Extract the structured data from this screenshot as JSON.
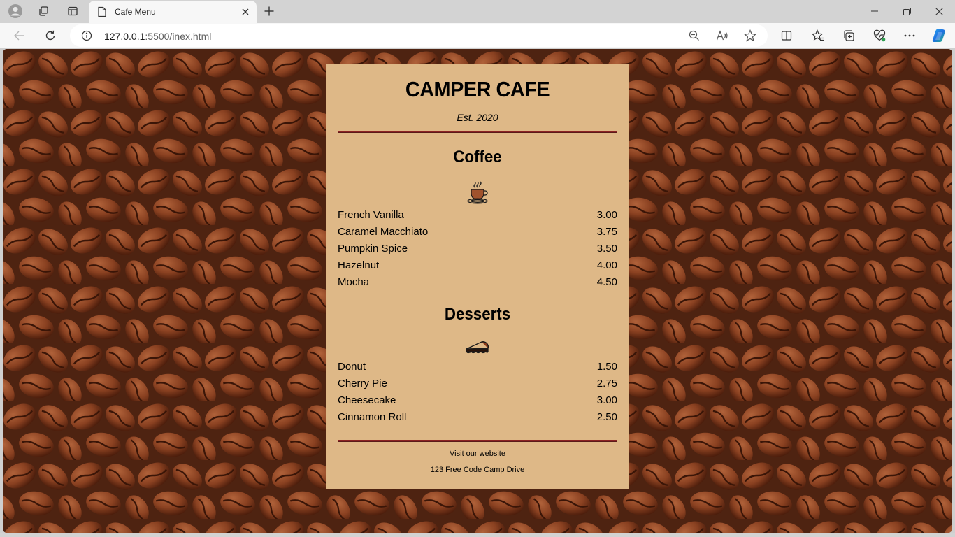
{
  "browser": {
    "tab_title": "Cafe Menu",
    "url_host": "127.0.0.1",
    "url_rest": ":5500/inex.html"
  },
  "page": {
    "title": "CAMPER CAFE",
    "established": "Est. 2020",
    "sections": [
      {
        "title": "Coffee",
        "icon": "coffee-cup-icon",
        "items": [
          {
            "name": "French Vanilla",
            "price": "3.00"
          },
          {
            "name": "Caramel Macchiato",
            "price": "3.75"
          },
          {
            "name": "Pumpkin Spice",
            "price": "3.50"
          },
          {
            "name": "Hazelnut",
            "price": "4.00"
          },
          {
            "name": "Mocha",
            "price": "4.50"
          }
        ]
      },
      {
        "title": "Desserts",
        "icon": "pie-slice-icon",
        "items": [
          {
            "name": "Donut",
            "price": "1.50"
          },
          {
            "name": "Cherry Pie",
            "price": "2.75"
          },
          {
            "name": "Cheesecake",
            "price": "3.00"
          },
          {
            "name": "Cinnamon Roll",
            "price": "2.50"
          }
        ]
      }
    ],
    "footer_link": "Visit our website",
    "footer_address": "123 Free Code Camp Drive"
  },
  "colors": {
    "menu_background": "#deb887",
    "rule": "#8b2323",
    "background": "#6b3219"
  }
}
